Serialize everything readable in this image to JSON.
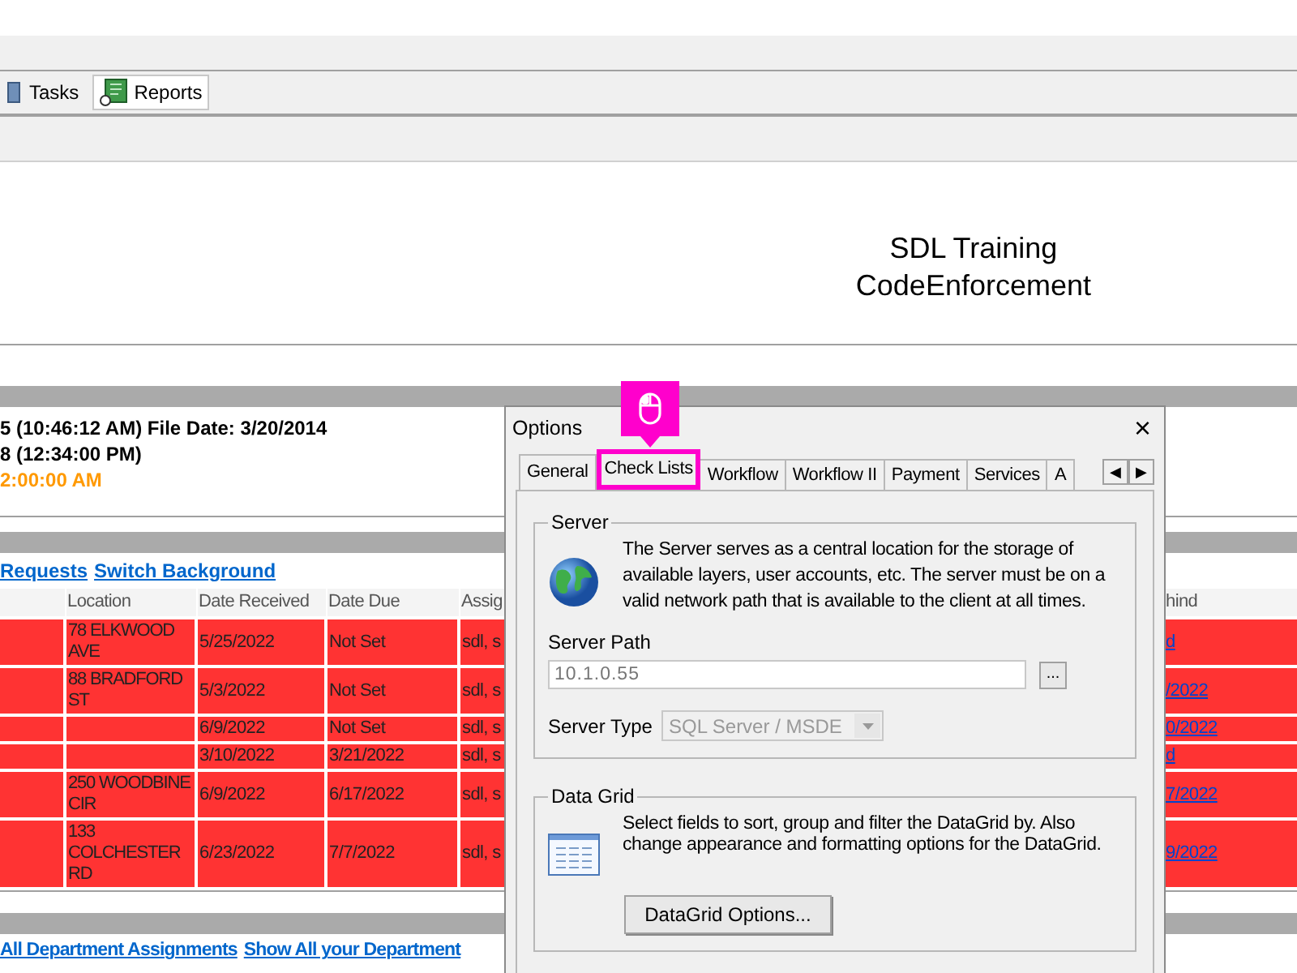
{
  "toolbar": {
    "tabs": [
      {
        "label": "Tasks",
        "kind": "tasks",
        "selected": false
      },
      {
        "label": "Reports",
        "kind": "reports",
        "selected": true
      }
    ]
  },
  "header": {
    "title_lines": [
      "SDL Training",
      "CodeEnforcement"
    ]
  },
  "record_info": [
    {
      "text": "5 (10:46:12 AM) File Date: 3/20/2014",
      "kind": "normal"
    },
    {
      "text": "8 (12:34:00 PM)",
      "kind": "normal"
    },
    {
      "text": "2:00:00 AM",
      "kind": "warning"
    }
  ],
  "links_top": [
    "Requests",
    "Switch Background"
  ],
  "table": {
    "columns": [
      "Location",
      "Date Received",
      "Date Due",
      "Assig",
      "hind"
    ],
    "rows": [
      {
        "location": "78 ELKWOOD AVE",
        "date_received": "5/25/2022",
        "date_due": "Not Set",
        "assigned": "sdl, s",
        "column_6": "d"
      },
      {
        "location": "88 BRADFORD ST",
        "date_received": "5/3/2022",
        "date_due": "Not Set",
        "assigned": "sdl, s",
        "column_6": "/2022"
      },
      {
        "location": "",
        "date_received": "6/9/2022",
        "date_due": "Not Set",
        "assigned": "sdl, s",
        "column_6": "0/2022"
      },
      {
        "location": "",
        "date_received": "3/10/2022",
        "date_due": "3/21/2022",
        "assigned": "sdl, s",
        "column_6": "d"
      },
      {
        "location": "250 WOODBINE CIR",
        "date_received": "6/9/2022",
        "date_due": "6/17/2022",
        "assigned": "sdl, s",
        "column_6": "7/2022"
      },
      {
        "location": "133 COLCHESTER RD",
        "date_received": "6/23/2022",
        "date_due": "7/7/2022",
        "assigned": "sdl, s",
        "column_6": "9/2022"
      }
    ]
  },
  "links_bottom": [
    "All Department Assignments",
    "Show All your Department"
  ],
  "dialog": {
    "title": "Options",
    "close": "×",
    "tabs": [
      {
        "label": "General",
        "selected": true,
        "highlighted": false
      },
      {
        "label": "Check Lists",
        "selected": false,
        "highlighted": true
      },
      {
        "label": "Workflow",
        "selected": false,
        "highlighted": false
      },
      {
        "label": "Workflow II",
        "selected": false,
        "highlighted": false
      },
      {
        "label": "Payment",
        "selected": false,
        "highlighted": false
      },
      {
        "label": "Services",
        "selected": false,
        "highlighted": false
      },
      {
        "label": "A",
        "selected": false,
        "highlighted": false
      }
    ],
    "tab_scroll": [
      "◀",
      "▶"
    ],
    "server": {
      "legend": "Server",
      "description": "The Server serves as a central location for the storage of available layers, user accounts, etc. The server must be on a valid network path that is available to the client at all times.",
      "path_label": "Server Path",
      "path_value": "10.1.0.55",
      "browse": "...",
      "type_label": "Server Type",
      "type_value": "SQL Server / MSDE",
      "type_disabled": true
    },
    "data_grid": {
      "legend": "Data Grid",
      "description": "Select fields to sort, group and filter the DataGrid by. Also change appearance and formatting options for the DataGrid.",
      "button": "DataGrid Options..."
    }
  }
}
